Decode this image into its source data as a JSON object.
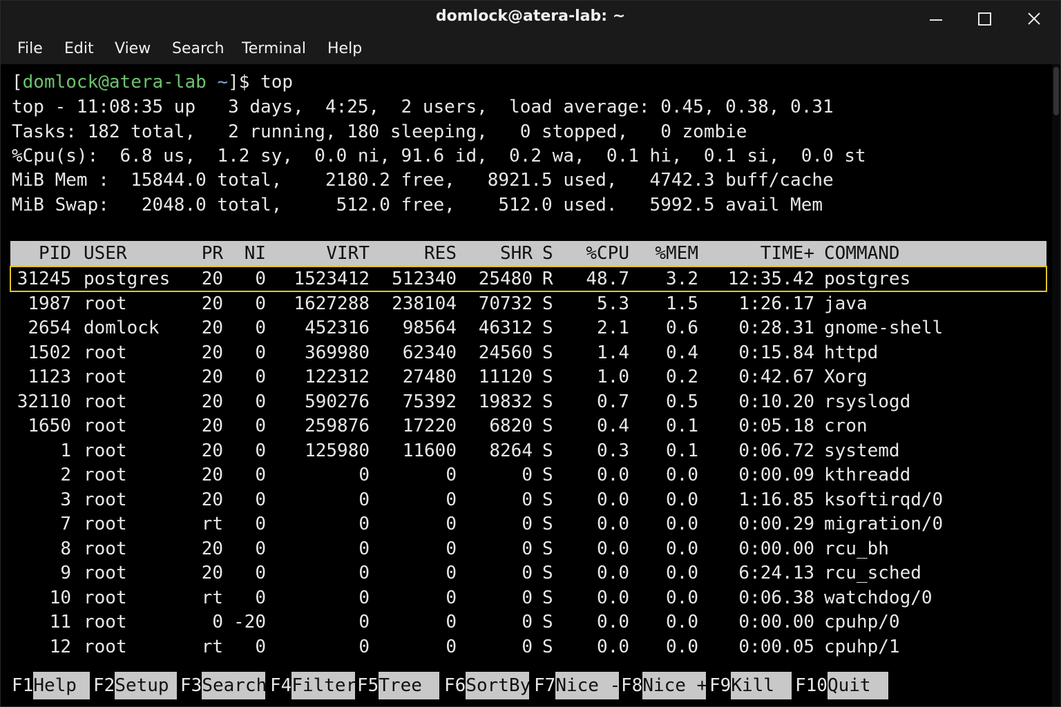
{
  "window": {
    "title": "domlock@atera-lab: ~",
    "minimize_icon": "minimize-icon",
    "maximize_icon": "maximize-icon",
    "close_icon": "close-icon"
  },
  "menu": [
    "File",
    "Edit",
    "View",
    "Search",
    "Terminal",
    "Help"
  ],
  "prompt": {
    "open": "[",
    "userhost": "domlock@atera-lab",
    "path": " ~",
    "close": "]$ ",
    "command": "top"
  },
  "summary": [
    "top - 11:08:35 up   3 days,  4:25,  2 users,  load average: 0.45, 0.38, 0.31",
    "Tasks: 182 total,   2 running, 180 sleeping,   0 stopped,   0 zombie",
    "%Cpu(s):  6.8 us,  1.2 sy,  0.0 ni, 91.6 id,  0.2 wa,  0.1 hi,  0.1 si,  0.0 st",
    "MiB Mem :  15844.0 total,    2180.2 free,   8921.5 used,   4742.3 buff/cache",
    "MiB Swap:   2048.0 total,     512.0 free,    512.0 used.   5992.5 avail Mem"
  ],
  "table": {
    "headers": [
      "PID",
      "USER",
      "PR",
      "NI",
      "VIRT",
      "RES",
      "SHR",
      "S",
      "%CPU",
      "%MEM",
      "TIME+",
      "COMMAND"
    ],
    "selected_index": 0,
    "rows": [
      [
        "31245",
        "postgres",
        "20",
        "0",
        "1523412",
        "512340",
        "25480",
        "R",
        "48.7",
        "3.2",
        "12:35.42",
        "postgres"
      ],
      [
        "1987",
        "root",
        "20",
        "0",
        "1627288",
        "238104",
        "70732",
        "S",
        "5.3",
        "1.5",
        "1:26.17",
        "java"
      ],
      [
        "2654",
        "domlock",
        "20",
        "0",
        "452316",
        "98564",
        "46312",
        "S",
        "2.1",
        "0.6",
        "0:28.31",
        "gnome-shell"
      ],
      [
        "1502",
        "root",
        "20",
        "0",
        "369980",
        "62340",
        "24560",
        "S",
        "1.4",
        "0.4",
        "0:15.84",
        "httpd"
      ],
      [
        "1123",
        "root",
        "20",
        "0",
        "122312",
        "27480",
        "11120",
        "S",
        "1.0",
        "0.2",
        "0:42.67",
        "Xorg"
      ],
      [
        "32110",
        "root",
        "20",
        "0",
        "590276",
        "75392",
        "19832",
        "S",
        "0.7",
        "0.5",
        "0:10.20",
        "rsyslogd"
      ],
      [
        "1650",
        "root",
        "20",
        "0",
        "259876",
        "17220",
        "6820",
        "S",
        "0.4",
        "0.1",
        "0:05.18",
        "cron"
      ],
      [
        "1",
        "root",
        "20",
        "0",
        "125980",
        "11600",
        "8264",
        "S",
        "0.3",
        "0.1",
        "0:06.72",
        "systemd"
      ],
      [
        "2",
        "root",
        "20",
        "0",
        "0",
        "0",
        "0",
        "S",
        "0.0",
        "0.0",
        "0:00.09",
        "kthreadd"
      ],
      [
        "3",
        "root",
        "20",
        "0",
        "0",
        "0",
        "0",
        "S",
        "0.0",
        "0.0",
        "1:16.85",
        "ksoftirqd/0"
      ],
      [
        "7",
        "root",
        "rt",
        "0",
        "0",
        "0",
        "0",
        "S",
        "0.0",
        "0.0",
        "0:00.29",
        "migration/0"
      ],
      [
        "8",
        "root",
        "20",
        "0",
        "0",
        "0",
        "0",
        "S",
        "0.0",
        "0.0",
        "0:00.00",
        "rcu_bh"
      ],
      [
        "9",
        "root",
        "20",
        "0",
        "0",
        "0",
        "0",
        "S",
        "0.0",
        "0.0",
        "6:24.13",
        "rcu_sched"
      ],
      [
        "10",
        "root",
        "rt",
        "0",
        "0",
        "0",
        "0",
        "S",
        "0.0",
        "0.0",
        "0:06.38",
        "watchdog/0"
      ],
      [
        "11",
        "root",
        "0",
        "-20",
        "0",
        "0",
        "0",
        "S",
        "0.0",
        "0.0",
        "0:00.00",
        "cpuhp/0"
      ],
      [
        "12",
        "root",
        "rt",
        "0",
        "0",
        "0",
        "0",
        "S",
        "0.0",
        "0.0",
        "0:00.05",
        "cpuhp/1"
      ]
    ]
  },
  "fkeys": [
    {
      "key": "F1",
      "label": "Help  "
    },
    {
      "key": "F2",
      "label": "Setup "
    },
    {
      "key": "F3",
      "label": "Search"
    },
    {
      "key": "F4",
      "label": "Filter"
    },
    {
      "key": "F5",
      "label": "Tree  "
    },
    {
      "key": "F6",
      "label": "SortBy"
    },
    {
      "key": "F7",
      "label": "Nice -"
    },
    {
      "key": "F8",
      "label": "Nice +"
    },
    {
      "key": "F9",
      "label": "Kill  "
    },
    {
      "key": "F10",
      "label": "Quit  "
    }
  ],
  "colors": {
    "prompt_user": "#6dc36d",
    "prompt_path": "#7fa6e0",
    "selection_border": "#e3c52a",
    "header_bg": "#c8c8c8"
  }
}
